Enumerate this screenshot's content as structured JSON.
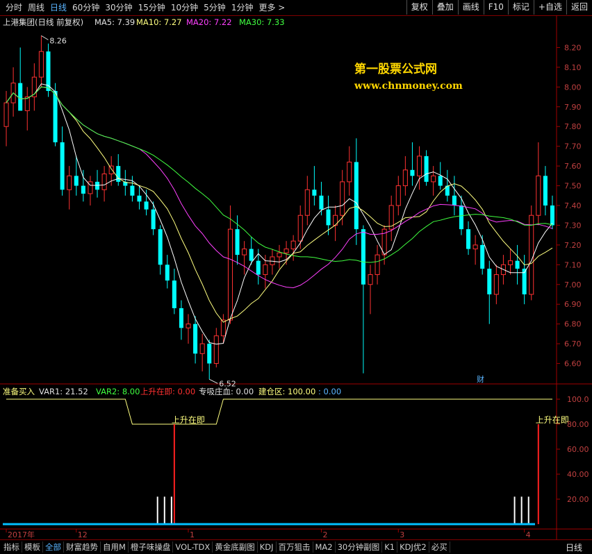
{
  "top_tabs": [
    {
      "label": "分时",
      "active": false
    },
    {
      "label": "周线",
      "active": false
    },
    {
      "label": "日线",
      "active": true
    },
    {
      "label": "60分钟",
      "active": false
    },
    {
      "label": "30分钟",
      "active": false
    },
    {
      "label": "15分钟",
      "active": false
    },
    {
      "label": "10分钟",
      "active": false
    },
    {
      "label": "5分钟",
      "active": false
    },
    {
      "label": "1分钟",
      "active": false
    },
    {
      "label": "更多 >",
      "active": false
    }
  ],
  "right_buttons": [
    "复权",
    "叠加",
    "画线",
    "F10",
    "标记",
    "+自选",
    "返回"
  ],
  "main_header": {
    "stock": "上港集团(日线 前复权)",
    "ma5": "MA5: 7.39",
    "ma10": "MA10: 7.27",
    "ma20": "MA20: 7.22",
    "ma30": "MA30: 7.33"
  },
  "watermark": {
    "line1": "第一股票公式网",
    "line2": "www.chnmoney.com"
  },
  "price_axis": [
    "8.20",
    "8.10",
    "8.00",
    "7.90",
    "7.80",
    "7.70",
    "7.60",
    "7.50",
    "7.40",
    "7.30",
    "7.20",
    "7.10",
    "7.00",
    "6.90",
    "6.80",
    "6.70",
    "6.60"
  ],
  "annotations": {
    "high": "8.26",
    "low": "6.52",
    "cai": "财"
  },
  "indicator_header": {
    "name": "准备买入",
    "var1": "VAR1: 21.52",
    "var2": "VAR2: 8.00",
    "up": "上升在即: 0.00",
    "absorb": "专吸庄血: 0.00",
    "build": "建仓区: 100.00",
    "build2": ": 0.00"
  },
  "indicator_axis": [
    "100.0",
    "80.00",
    "60.00",
    "40.00",
    "20.00"
  ],
  "indicator_labels": [
    "上升在即",
    "上升在即"
  ],
  "date_axis": [
    "2017年",
    "12",
    "1",
    "2",
    "3",
    "4"
  ],
  "bottom_tabs": [
    {
      "label": "指标",
      "active": false
    },
    {
      "label": "模板",
      "active": false
    },
    {
      "label": "全部",
      "active": true
    },
    {
      "label": "财富趋势",
      "active": false
    },
    {
      "label": "自用M",
      "active": false
    },
    {
      "label": "橙子味操盘",
      "active": false
    },
    {
      "label": "VOL-TDX",
      "active": false
    },
    {
      "label": "黄金底副图",
      "active": false
    },
    {
      "label": "KDJ",
      "active": false
    },
    {
      "label": "百万狙击",
      "active": false
    },
    {
      "label": "MA2",
      "active": false
    },
    {
      "label": "30分钟副图",
      "active": false
    },
    {
      "label": "K1",
      "active": false
    },
    {
      "label": "KDJ优2",
      "active": false
    },
    {
      "label": "必买",
      "active": false
    }
  ],
  "period_label": "日线",
  "chart_data": {
    "type": "candlestick",
    "y_range": [
      6.5,
      8.3
    ],
    "candles_ohlc": [
      [
        7.8,
        7.98,
        7.7,
        7.92
      ],
      [
        7.92,
        8.1,
        7.85,
        8.02
      ],
      [
        8.02,
        8.2,
        7.95,
        7.88
      ],
      [
        7.88,
        8.0,
        7.78,
        7.95
      ],
      [
        7.95,
        8.12,
        7.88,
        8.05
      ],
      [
        8.05,
        8.26,
        8.0,
        8.18
      ],
      [
        8.18,
        8.22,
        7.95,
        7.98
      ],
      [
        7.98,
        8.02,
        7.7,
        7.72
      ],
      [
        7.72,
        7.8,
        7.45,
        7.48
      ],
      [
        7.48,
        7.6,
        7.38,
        7.55
      ],
      [
        7.55,
        7.65,
        7.45,
        7.5
      ],
      [
        7.5,
        7.58,
        7.42,
        7.46
      ],
      [
        7.46,
        7.55,
        7.4,
        7.52
      ],
      [
        7.52,
        7.58,
        7.44,
        7.48
      ],
      [
        7.48,
        7.6,
        7.42,
        7.56
      ],
      [
        7.56,
        7.65,
        7.5,
        7.6
      ],
      [
        7.6,
        7.66,
        7.5,
        7.52
      ],
      [
        7.52,
        7.58,
        7.45,
        7.5
      ],
      [
        7.5,
        7.55,
        7.42,
        7.45
      ],
      [
        7.45,
        7.5,
        7.38,
        7.42
      ],
      [
        7.42,
        7.48,
        7.35,
        7.38
      ],
      [
        7.38,
        7.42,
        7.25,
        7.28
      ],
      [
        7.28,
        7.3,
        7.05,
        7.1
      ],
      [
        7.1,
        7.15,
        6.98,
        7.02
      ],
      [
        7.02,
        7.08,
        6.85,
        6.88
      ],
      [
        6.88,
        6.92,
        6.72,
        6.78
      ],
      [
        6.78,
        6.85,
        6.7,
        6.8
      ],
      [
        6.8,
        6.84,
        6.6,
        6.65
      ],
      [
        6.65,
        6.75,
        6.56,
        6.7
      ],
      [
        6.7,
        6.72,
        6.52,
        6.6
      ],
      [
        6.6,
        6.78,
        6.58,
        6.74
      ],
      [
        6.74,
        6.85,
        6.7,
        6.82
      ],
      [
        6.82,
        7.4,
        6.8,
        7.28
      ],
      [
        7.28,
        7.35,
        7.1,
        7.15
      ],
      [
        7.15,
        7.22,
        7.05,
        7.18
      ],
      [
        7.18,
        7.24,
        7.1,
        7.12
      ],
      [
        7.12,
        7.18,
        7.0,
        7.05
      ],
      [
        7.05,
        7.15,
        6.98,
        7.1
      ],
      [
        7.1,
        7.18,
        7.05,
        7.14
      ],
      [
        7.14,
        7.2,
        7.08,
        7.16
      ],
      [
        7.16,
        7.22,
        7.1,
        7.18
      ],
      [
        7.18,
        7.25,
        7.12,
        7.22
      ],
      [
        7.22,
        7.4,
        7.18,
        7.35
      ],
      [
        7.35,
        7.55,
        7.3,
        7.48
      ],
      [
        7.48,
        7.6,
        7.4,
        7.45
      ],
      [
        7.45,
        7.52,
        7.35,
        7.38
      ],
      [
        7.38,
        7.45,
        7.25,
        7.3
      ],
      [
        7.3,
        7.4,
        7.22,
        7.35
      ],
      [
        7.35,
        7.58,
        7.3,
        7.52
      ],
      [
        7.52,
        7.7,
        7.45,
        7.62
      ],
      [
        7.62,
        7.74,
        7.2,
        7.28
      ],
      [
        7.28,
        7.3,
        6.55,
        7.0
      ],
      [
        7.0,
        7.1,
        6.85,
        7.05
      ],
      [
        7.05,
        7.2,
        7.0,
        7.15
      ],
      [
        7.15,
        7.3,
        7.1,
        7.28
      ],
      [
        7.28,
        7.45,
        7.22,
        7.4
      ],
      [
        7.4,
        7.55,
        7.35,
        7.5
      ],
      [
        7.5,
        7.65,
        7.45,
        7.58
      ],
      [
        7.58,
        7.72,
        7.5,
        7.55
      ],
      [
        7.55,
        7.7,
        7.48,
        7.65
      ],
      [
        7.65,
        7.68,
        7.5,
        7.52
      ],
      [
        7.52,
        7.6,
        7.45,
        7.55
      ],
      [
        7.55,
        7.62,
        7.48,
        7.5
      ],
      [
        7.5,
        7.58,
        7.42,
        7.45
      ],
      [
        7.45,
        7.55,
        7.35,
        7.4
      ],
      [
        7.4,
        7.45,
        7.25,
        7.28
      ],
      [
        7.28,
        7.32,
        7.15,
        7.18
      ],
      [
        7.18,
        7.25,
        7.1,
        7.2
      ],
      [
        7.2,
        7.25,
        7.05,
        7.08
      ],
      [
        7.08,
        7.12,
        6.8,
        6.95
      ],
      [
        6.95,
        7.1,
        6.9,
        7.05
      ],
      [
        7.05,
        7.15,
        7.0,
        7.1
      ],
      [
        7.1,
        7.18,
        7.05,
        7.12
      ],
      [
        7.12,
        7.2,
        7.0,
        7.08
      ],
      [
        7.08,
        7.15,
        6.9,
        6.95
      ],
      [
        6.95,
        7.4,
        6.92,
        7.35
      ],
      [
        7.35,
        7.72,
        7.3,
        7.55
      ],
      [
        7.55,
        7.6,
        7.35,
        7.4
      ],
      [
        7.4,
        7.45,
        7.28,
        7.3
      ]
    ],
    "ma_colors": {
      "ma5": "#ffffff",
      "ma10": "#ffff80",
      "ma20": "#ff40ff",
      "ma30": "#40ff40"
    },
    "indicator": {
      "y_range": [
        0,
        100
      ],
      "build_zone_line": [
        100,
        100,
        100,
        100,
        100,
        100,
        100,
        100,
        100,
        100,
        100,
        100,
        100,
        100,
        100,
        100,
        100,
        100,
        100,
        100,
        100,
        100,
        100,
        100,
        100,
        100,
        100,
        100,
        100,
        100,
        100,
        100,
        100,
        100,
        100,
        100,
        100,
        100,
        100,
        100,
        100,
        100,
        100,
        100,
        100,
        100,
        100,
        100,
        100,
        100,
        100,
        100,
        100,
        100,
        100,
        100,
        100,
        100,
        100,
        100,
        100,
        100,
        100,
        100,
        100,
        100,
        100,
        100,
        100,
        100,
        100,
        100,
        100,
        100,
        100,
        100,
        100,
        100,
        100
      ],
      "var2_dip": {
        "from_candle": 18,
        "to_candle": 30,
        "value": 80
      },
      "up_bars": [
        {
          "candle": 24,
          "value": 80
        },
        {
          "candle": 76,
          "value": 80
        }
      ],
      "white_bars": [
        22,
        23,
        24,
        73,
        74,
        75
      ]
    }
  }
}
